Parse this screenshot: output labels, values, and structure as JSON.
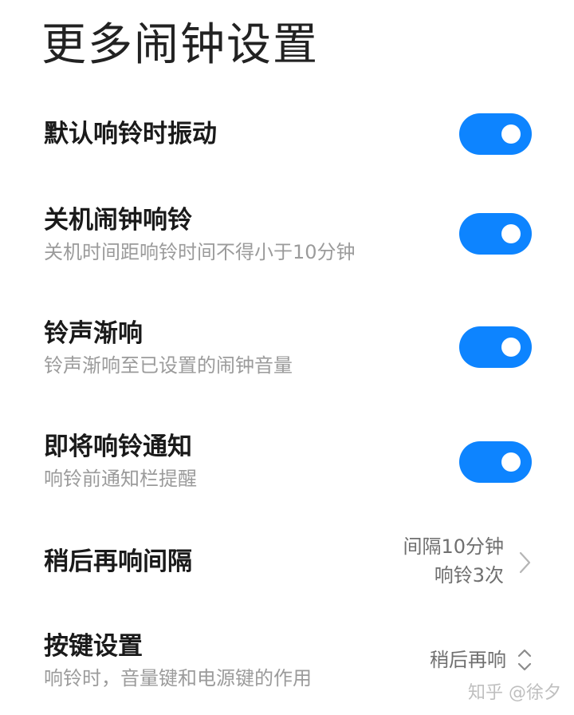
{
  "header": {
    "title": "更多闹钟设置"
  },
  "settings": [
    {
      "title": "默认响铃时振动",
      "desc": "",
      "toggle_on": true
    },
    {
      "title": "关机闹钟响铃",
      "desc": "关机时间距响铃时间不得小于10分钟",
      "toggle_on": true
    },
    {
      "title": "铃声渐响",
      "desc": "铃声渐响至已设置的闹钟音量",
      "toggle_on": true
    },
    {
      "title": "即将响铃通知",
      "desc": "响铃前通知栏提醒",
      "toggle_on": true
    },
    {
      "title": "稍后再响间隔",
      "value_line1": "间隔10分钟",
      "value_line2": "响铃3次",
      "icon": "chevron-right-icon"
    },
    {
      "title": "按键设置",
      "desc": "响铃时，音量键和电源键的作用",
      "value": "稍后再响",
      "icon": "up-down-icon"
    }
  ],
  "watermark": "知乎 @徐夕",
  "colors": {
    "accent": "#0d84ff",
    "title_text": "#1a1a1a",
    "desc_text": "#9b9b9b"
  }
}
